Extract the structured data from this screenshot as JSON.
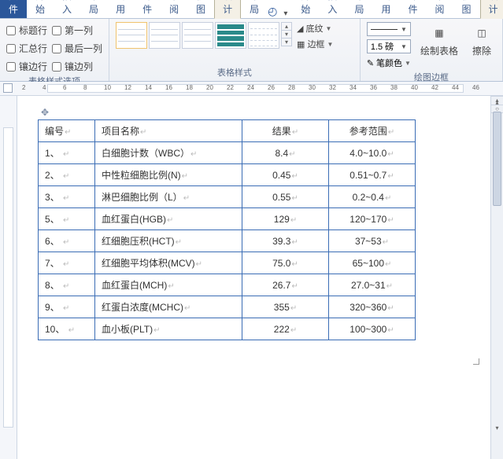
{
  "tabs": {
    "file": "文件",
    "items": [
      "开始",
      "插入",
      "页面布局",
      "引用",
      "邮件",
      "审阅",
      "视图",
      "设计",
      "布局"
    ],
    "active_index": 7
  },
  "ribbon": {
    "style_options": {
      "label": "表格样式选项",
      "col1": [
        "标题行",
        "汇总行",
        "镶边行"
      ],
      "col2": [
        "第一列",
        "最后一列",
        "镶边列"
      ]
    },
    "table_styles": {
      "label": "表格样式",
      "shading": "底纹",
      "borders": "边框"
    },
    "draw_borders": {
      "label": "绘图边框",
      "weight": "1.5 磅",
      "pen_color": "笔颜色",
      "draw": "绘制表格",
      "erase": "擦除"
    }
  },
  "ruler": {
    "marks": [
      2,
      4,
      6,
      8,
      10,
      12,
      14,
      16,
      18,
      20,
      22,
      24,
      26,
      28,
      30,
      32,
      34,
      36,
      38,
      40,
      42,
      44,
      46
    ]
  },
  "table": {
    "headers": {
      "num": "编号",
      "name": "项目名称",
      "result": "结果",
      "ref": "参考范围"
    },
    "rows": [
      {
        "num": "1、",
        "name": "白细胞计数（WBC）",
        "result": "8.4",
        "ref": "4.0~10.0"
      },
      {
        "num": "2、",
        "name": "中性粒细胞比例(N)",
        "result": "0.45",
        "ref": "0.51~0.7"
      },
      {
        "num": "3、",
        "name": "淋巴细胞比例（L）",
        "result": "0.55",
        "ref": "0.2~0.4"
      },
      {
        "num": "5、",
        "name": "血红蛋白(HGB)",
        "result": "129",
        "ref": "120~170"
      },
      {
        "num": "6、",
        "name": "红细胞压积(HCT)",
        "result": "39.3",
        "ref": "37~53"
      },
      {
        "num": "7、",
        "name": "红细胞平均体积(MCV)",
        "result": "75.0",
        "ref": "65~100"
      },
      {
        "num": "8、",
        "name": "血红蛋白(MCH)",
        "result": "26.7",
        "ref": "27.0~31"
      },
      {
        "num": "9、",
        "name": "红蛋白浓度(MCHC)",
        "result": "355",
        "ref": "320~360"
      },
      {
        "num": "10、",
        "name": "血小板(PLT)",
        "result": "222",
        "ref": "100~300"
      }
    ]
  }
}
